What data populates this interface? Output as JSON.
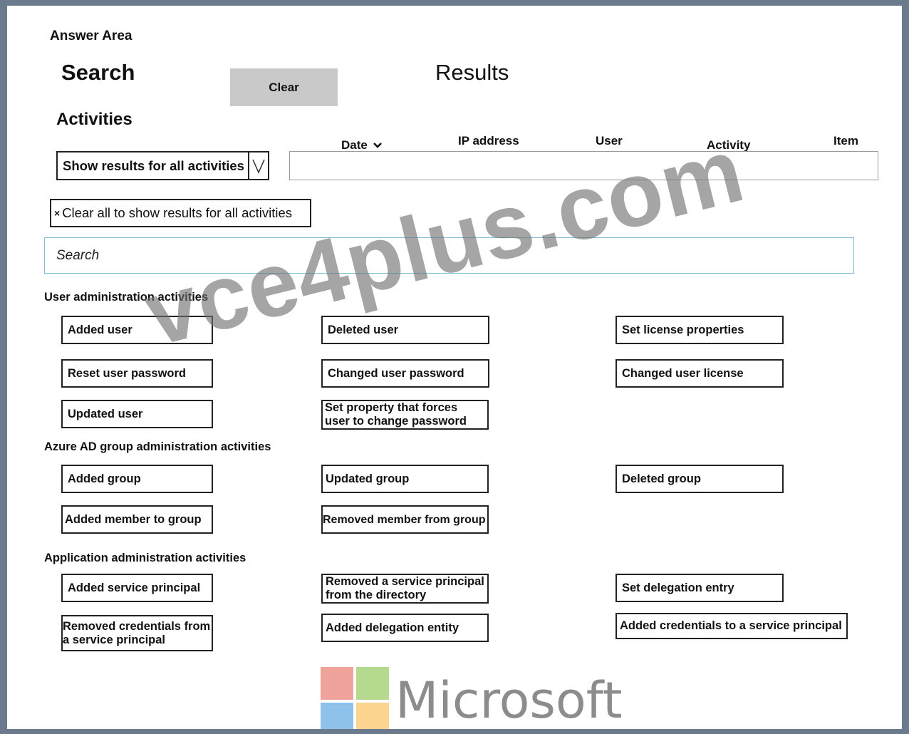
{
  "header": {
    "answer_area": "Answer Area",
    "search_title": "Search",
    "clear_label": "Clear",
    "results_title": "Results",
    "activities_title": "Activities"
  },
  "results_columns": [
    "Date",
    "IP address",
    "User",
    "Activity",
    "Item"
  ],
  "dropdown": {
    "selected": "Show results for all activities",
    "icon": "chevron-down-icon"
  },
  "clear_all": {
    "icon": "×",
    "label": "Clear all to show results for all activities"
  },
  "search": {
    "placeholder": "Search"
  },
  "sections": {
    "user_admin": {
      "title": "User administration activities",
      "items": [
        "Added user",
        "Deleted user",
        "Set license properties",
        "Reset user password",
        "Changed user password",
        "Changed user license",
        "Updated user",
        "Set property that forces user to change password"
      ]
    },
    "group_admin": {
      "title": "Azure AD group administration activities",
      "items": [
        "Added group",
        "Updated group",
        "Deleted group",
        "Added member to group",
        "Removed member from group"
      ]
    },
    "app_admin": {
      "title": "Application administration activities",
      "items": [
        "Added service principal",
        "Removed a service principal from the directory",
        "Set delegation entry",
        "Removed credentials from a service principal",
        "Added delegation entity",
        "Added credentials to a service principal"
      ]
    }
  },
  "watermark": "vce4plus.com",
  "brand": {
    "name": "Microsoft",
    "logo_colors": [
      "#f0a39a",
      "#b5d98f",
      "#8fc2ea",
      "#fbd490"
    ]
  }
}
